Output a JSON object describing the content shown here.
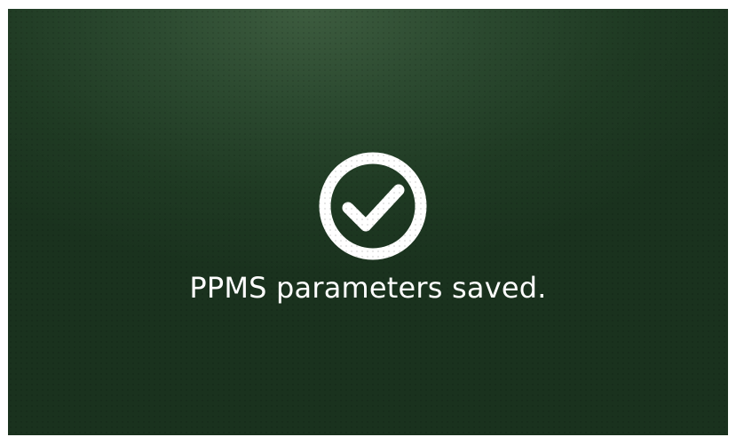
{
  "dialog": {
    "icon": "check-circle-icon",
    "message": "PPMS parameters saved.",
    "colors": {
      "background": "#1f3a23",
      "foreground": "#ffffff"
    }
  }
}
